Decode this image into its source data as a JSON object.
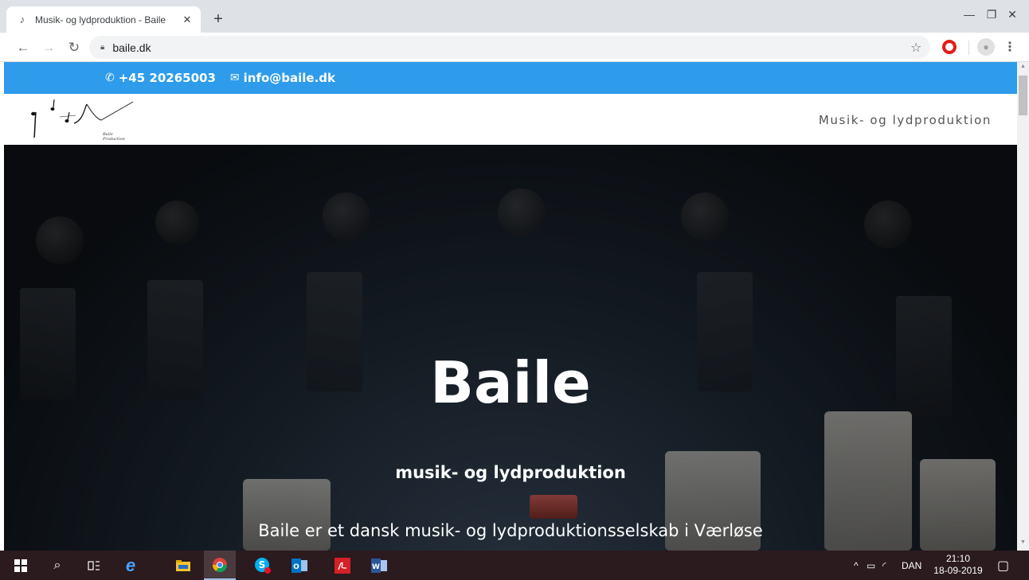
{
  "browser": {
    "tab_title": "Musik- og lydproduktion - Baile",
    "tab_close": "✕",
    "new_tab": "+",
    "url": "baile.dk",
    "minimize": "—",
    "maximize": "❐",
    "close": "✕"
  },
  "site": {
    "phone": "+45 20265003",
    "email": "info@baile.dk",
    "logo_caption": "Baile Production",
    "nav_label": "Musik- og lydproduktion",
    "hero_title": "Baile",
    "hero_subtitle": "musik- og lydproduktion",
    "hero_description": "Baile er et dansk musik- og lydproduktionsselskab i Værløse"
  },
  "taskbar": {
    "language": "DAN",
    "time": "21:10",
    "date": "18-09-2019"
  },
  "colors": {
    "contact_bar": "#2e9ceb",
    "taskbar": "#2b1a1e"
  }
}
